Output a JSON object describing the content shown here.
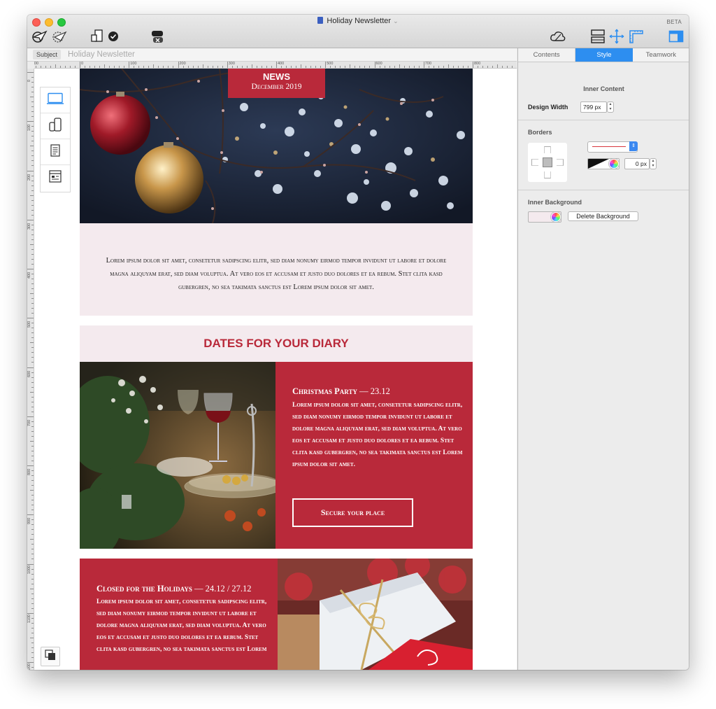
{
  "window": {
    "title": "Holiday Newsletter",
    "badge": "BETA"
  },
  "toolbar": {
    "left_icons": [
      "send-icon",
      "schedule-icon",
      "document-check-icon",
      "dismiss-icon"
    ],
    "right_icons": [
      "cloud-icon",
      "layout-icon",
      "move-icon",
      "ruler-icon",
      "panel-icon"
    ]
  },
  "subject": {
    "label": "Subject",
    "value": "Holiday Newsletter"
  },
  "ruler": {
    "top_labels": [
      "100",
      "0",
      "100",
      "200",
      "300",
      "400",
      "500",
      "600",
      "700",
      "800"
    ],
    "left_labels": [
      "0",
      "100",
      "200",
      "300",
      "400",
      "500",
      "600",
      "700",
      "800",
      "900",
      "1000",
      "1100",
      "1200"
    ]
  },
  "devices": {
    "items": [
      "desktop-preview-icon",
      "mobile-preview-icon",
      "text-preview-icon",
      "web-preview-icon"
    ]
  },
  "newsletter": {
    "header": {
      "title": "NEWS",
      "date": "December 2019"
    },
    "intro": "Lorem ipsum dolor sit amet, consetetur sadipscing elitr, sed diam nonumy eirmod tempor invidunt ut labore et dolore magna aliquyam erat, sed diam voluptua. At vero eos et accusam et justo duo dolores et ea rebum. Stet clita kasd gubergren, no sea takimata sanctus est Lorem ipsum dolor sit amet.",
    "dates_heading": "DATES FOR YOUR DIARY",
    "event1": {
      "name": "Christmas Party",
      "separator": " — ",
      "date": "23.12",
      "body": "Lorem ipsum dolor sit amet, consetetur sadipscing elitr, sed diam nonumy eirmod tempor invidunt ut labore et dolore magna aliquyam erat, sed diam voluptua. At vero eos et accusam et justo duo dolores et ea rebum. Stet clita kasd gubergren, no sea takimata sanctus est Lorem ipsum dolor sit amet.",
      "button": "Secure your place"
    },
    "event2": {
      "name": "Closed for the Holidays",
      "separator": " — ",
      "date": "24.12 / 27.12",
      "body": "Lorem ipsum dolor sit amet, consetetur sadipscing elitr, sed diam nonumy eirmod tempor invidunt ut labore et dolore magna aliquyam erat, sed diam voluptua. At vero eos et accusam et justo duo dolores et ea rebum. Stet clita kasd gubergren, no sea takimata sanctus est Lorem"
    }
  },
  "inspector": {
    "tabs": [
      "Contents",
      "Style",
      "Teamwork"
    ],
    "active_tab": "Style",
    "inner_content": {
      "title": "Inner Content",
      "design_width_label": "Design Width",
      "design_width_value": "799 px"
    },
    "borders": {
      "title": "Borders",
      "width_value": "0 px"
    },
    "inner_background": {
      "title": "Inner Background",
      "delete_label": "Delete Background"
    }
  },
  "colors": {
    "accent": "#b9293a",
    "pink_background": "#f4eaee",
    "selected_tab": "#2d8ef0"
  }
}
